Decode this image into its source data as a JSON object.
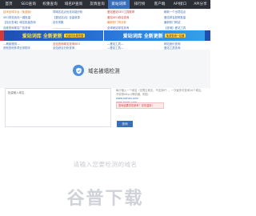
{
  "nav": {
    "items": [
      "首页",
      "SEO查询",
      "权重查询",
      "域名IP查询",
      "友情查询",
      "爱站词库",
      "排行榜",
      "客户端",
      "API接口",
      "API分享"
    ]
  },
  "links": {
    "row1": [
      "技术全球平台（免费版）",
      "同域名站点优化功能分析",
      "爱站爱站SEO工具推荐",
      "刷新一个出境站点"
    ],
    "row2": [
      "SEO排名优化一键批量",
      "【爱站站点】全量收录",
      "爱站SEO综合查询",
      "爱站排名趋势批量"
    ],
    "row3": [
      "【站长查询】域名批量查询",
      "站长采集",
      "最新热门词分析",
      "最新热门网站"
    ],
    "row4": [
      "百度查询报名广告查询",
      "------------------",
      "全球网站排名查询",
      "【查询】爱站工具"
    ]
  },
  "banners": {
    "left_title": "爱站词库 全新更新",
    "left_sub": "关键词长尾挖掘",
    "right_title": "爱站词库 全新更新",
    "right_sub": "免费查询一站通"
  },
  "links2": {
    "row1": [
      "---刷新服务---",
      "全站查询域名查询SEO",
      "—爱站工具—",
      "网站竞价查询"
    ],
    "row2": [
      "其他查询多项业务助手",
      "全站综合分析查询",
      "—爱站工具—",
      "爱站工具查询"
    ]
  },
  "tool": {
    "title": "域名被墙检测",
    "icon": "shield-icon"
  },
  "form": {
    "placeholder": "批量输入域名",
    "help_text": "每行输入一个域名（仅限主域名，不支持IP），一次最多可查询20个域名，不用带http://等前缀，例如：",
    "examples": [
      "www.aizhan.com",
      "www.baidu.com"
    ],
    "notice": "查询结果仅供参考！请勿滥用！",
    "query_label": "查询"
  },
  "hero": {
    "placeholder_text": "请输入您要检测的域名",
    "logo_text": "谷普下载"
  },
  "colors": {
    "accent": "#3a6fb8",
    "nav_bg": "#2c2f36",
    "danger": "#d23b3b"
  }
}
